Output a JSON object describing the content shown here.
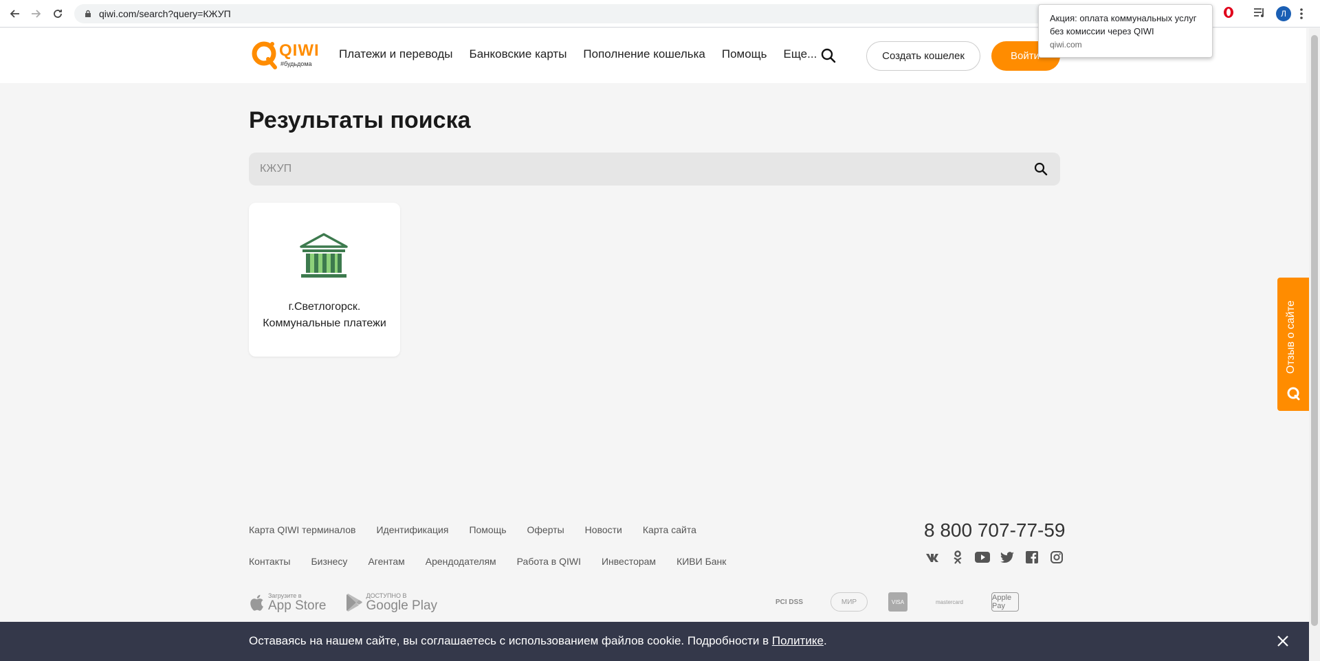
{
  "browser": {
    "url": "qiwi.com/search?query=КЖУП",
    "profile_initial": "Л"
  },
  "notification": {
    "title": "Акция: оплата коммунальных услуг без комиссии через QIWI",
    "source": "qiwi.com"
  },
  "header": {
    "logo_text": "QIWI",
    "logo_tag": "#будьдома",
    "nav": [
      "Платежи и переводы",
      "Банковские карты",
      "Пополнение кошелька",
      "Помощь",
      "Еще..."
    ],
    "create_wallet": "Создать кошелек",
    "login": "Войти"
  },
  "main": {
    "title": "Результаты поиска",
    "search_value": "КЖУП",
    "result": {
      "label": "г.Светлогорск. Коммунальные платежи"
    }
  },
  "feedback": {
    "label": "Отзыв о сайте"
  },
  "footer": {
    "links_row1": [
      "Карта QIWI терминалов",
      "Идентификация",
      "Помощь",
      "Оферты",
      "Новости",
      "Карта сайта"
    ],
    "links_row2": [
      "Контакты",
      "Бизнесу",
      "Агентам",
      "Арендодателям",
      "Работа в QIWI",
      "Инвесторам",
      "КИВИ Банк"
    ],
    "phone": "8 800 707-77-59",
    "appstore_small": "Загрузите в",
    "appstore_big": "App Store",
    "gplay_small": "ДОСТУПНО В",
    "gplay_big": "Google Play",
    "payments": [
      "PCI DSS",
      "МИР",
      "VISA",
      "mastercard",
      "Apple Pay"
    ]
  },
  "cookie": {
    "text": "Оставаясь на нашем сайте, вы соглашаетесь с использованием файлов cookie. Подробности в ",
    "link": "Политике",
    "end": "."
  },
  "colors": {
    "accent": "#ff8c00",
    "cookie_bg": "#34384a",
    "icon_green": "#3d7a4e"
  }
}
